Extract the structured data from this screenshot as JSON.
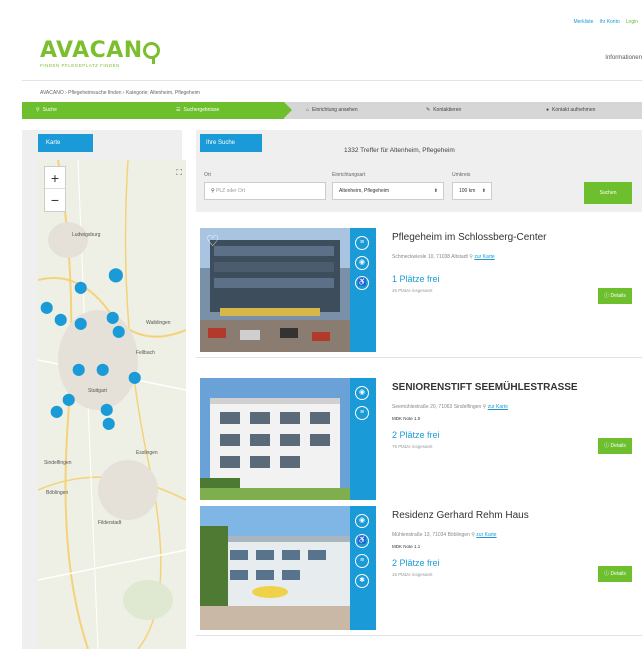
{
  "header": {
    "top_links": [
      "Merkliste",
      "Ihr Konto",
      "Login"
    ],
    "logo": "AVACANO",
    "tagline": "FINDEN PFLEGEPLATZ FINDEN",
    "info": "Informationen"
  },
  "breadcrumb": "AVACANO › Pflegeheimsuche finden › Kategorie: Altenheim, Pflegeheim",
  "steps": [
    {
      "label": "Suche",
      "icon": "search-icon",
      "active": true
    },
    {
      "label": "Suchergebnisse",
      "icon": "list-icon",
      "active": true
    },
    {
      "label": "Einrichtung ansehen",
      "icon": "home-icon",
      "active": false
    },
    {
      "label": "Kontaktieren",
      "icon": "edit-icon",
      "active": false
    },
    {
      "label": "Kontakt aufnehmen",
      "icon": "chat-icon",
      "active": false
    }
  ],
  "sidebar": {
    "tab": "Karte",
    "map_labels": [
      "Ludwigsburg",
      "Stuttgart",
      "Esslingen",
      "Böblingen",
      "Sindelfingen",
      "Fellbach",
      "Waiblingen",
      "Filderstadt"
    ]
  },
  "search": {
    "tab": "Ihre Suche",
    "result_count": "1332 Treffer für Altenheim, Pflegeheim",
    "ort_label": "Ort",
    "ort_placeholder": "PLZ oder Ort",
    "type_label": "Einrichtungsart",
    "type_value": "Altenheim, Pflegeheim",
    "radius_label": "Umkreis",
    "radius_value": "100 km",
    "button": "Suchen"
  },
  "results": [
    {
      "title": "Pflegeheim im Schlossberg-Center",
      "address": "Schmeckwiesle 10, 71038 Altstadt",
      "map_link": "zur Karte",
      "note": "",
      "free": "1 Plätze frei",
      "total": "45 Plätze insgesamt",
      "button": "Details"
    },
    {
      "title": "SENIORENSTIFT SEEMÜHLESTRASSE",
      "address": "Seemühlestraße 20, 71063 Sindelfingen",
      "map_link": "zur Karte",
      "note": "MDK Note 1.0",
      "free": "2 Plätze frei",
      "total": "75 Plätze insgesamt",
      "button": "Details"
    },
    {
      "title": "Residenz Gerhard Rehm Haus",
      "address": "Mühlenstraße 13, 71034 Böblingen",
      "map_link": "zur Karte",
      "note": "MDK Note 1.1",
      "free": "2 Plätze frei",
      "total": "16 Plätze insgesamt",
      "button": "Details"
    }
  ],
  "colors": {
    "green": "#6dbf2e",
    "blue": "#1a9bd7"
  }
}
